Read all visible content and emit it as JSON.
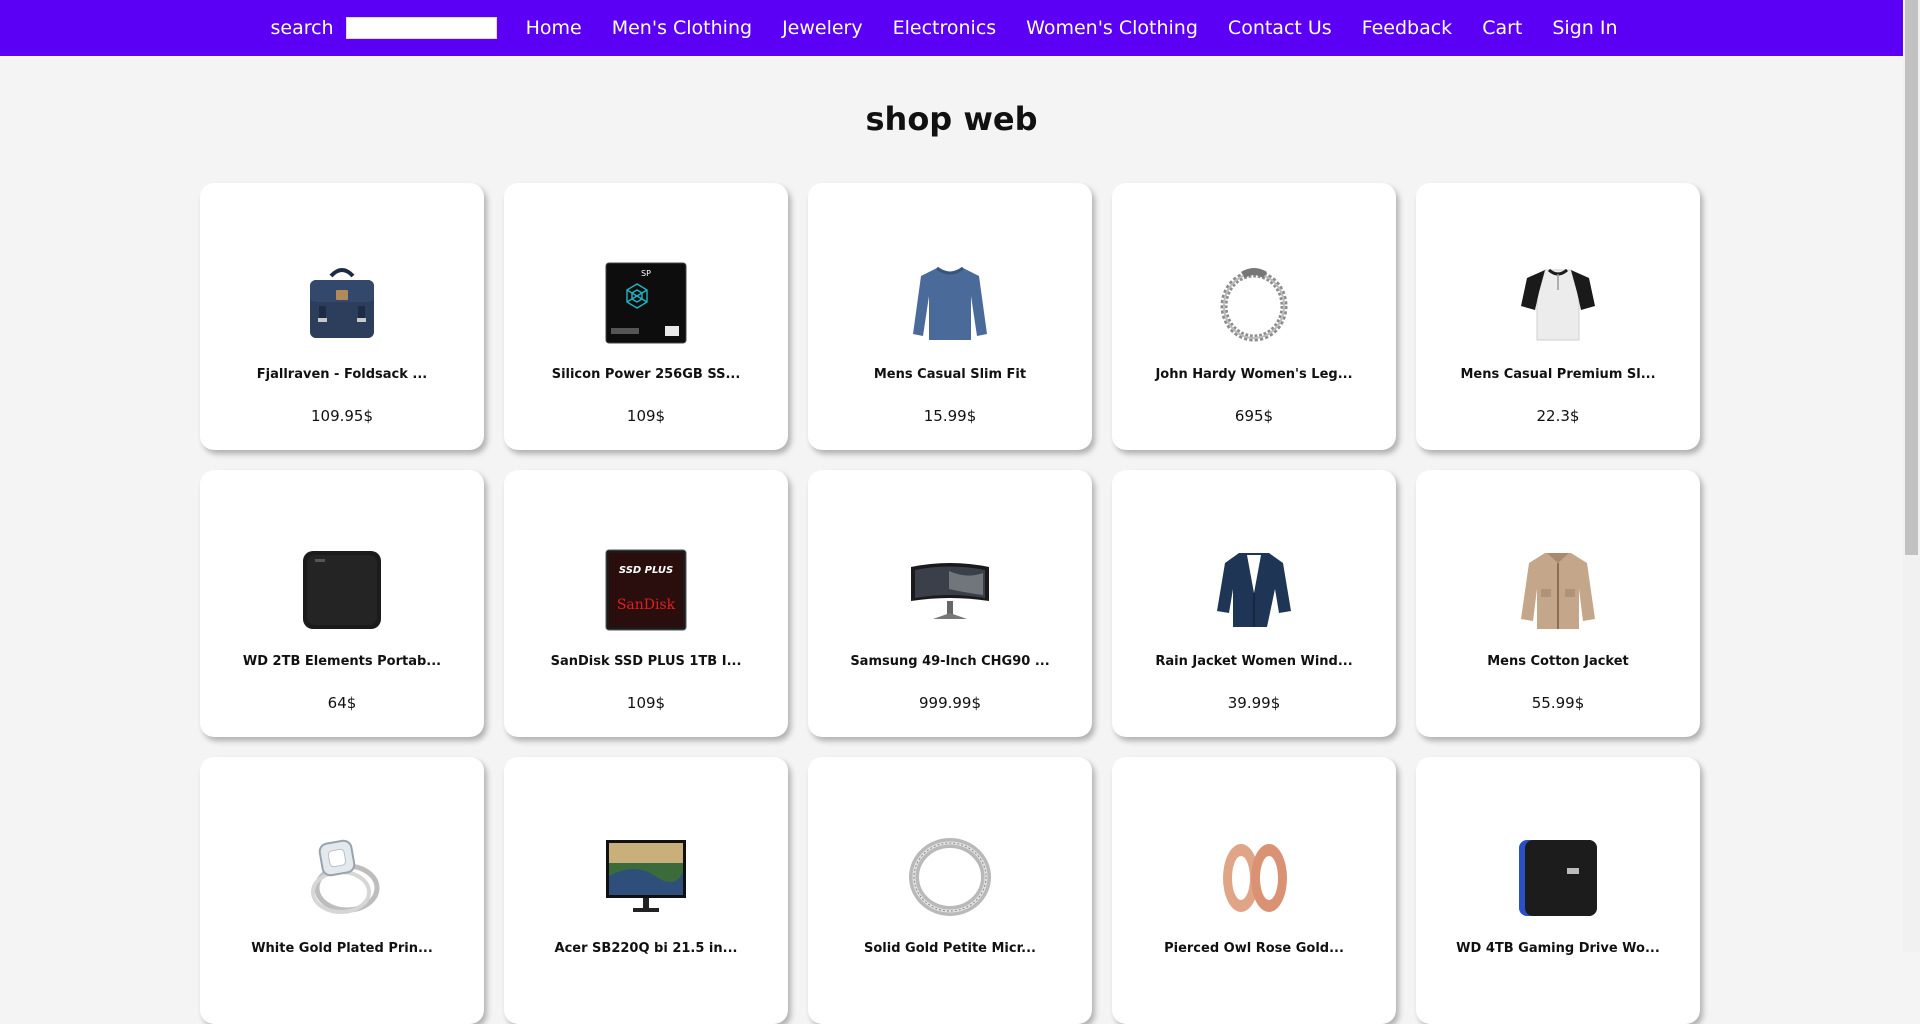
{
  "nav": {
    "search_label": "search",
    "search_value": "",
    "links": [
      "Home",
      "Men's Clothing",
      "Jewelery",
      "Electronics",
      "Women's Clothing",
      "Contact Us",
      "Feedback",
      "Cart",
      "Sign In"
    ]
  },
  "page": {
    "title": "shop web"
  },
  "colors": {
    "navbar": "#5b00f5",
    "background": "#f4f4f4",
    "card": "#ffffff"
  },
  "products": [
    {
      "title": "Fjallraven - Foldsack ...",
      "price": "109.95$",
      "icon": "backpack-icon"
    },
    {
      "title": "Silicon Power 256GB SS...",
      "price": "109$",
      "icon": "ssd-icon",
      "image_text": "SP"
    },
    {
      "title": "Mens Casual Slim Fit",
      "price": "15.99$",
      "icon": "long-sleeve-shirt-icon"
    },
    {
      "title": "John Hardy Women's Leg...",
      "price": "695$",
      "icon": "bracelet-icon"
    },
    {
      "title": "Mens Casual Premium Sl...",
      "price": "22.3$",
      "icon": "raglan-tshirt-icon"
    },
    {
      "title": "WD 2TB Elements Portab...",
      "price": "64$",
      "icon": "hard-drive-icon"
    },
    {
      "title": "SanDisk SSD PLUS 1TB I...",
      "price": "109$",
      "icon": "sandisk-ssd-icon",
      "image_text": "SSD PLUS",
      "image_brand": "SanDisk"
    },
    {
      "title": "Samsung 49-Inch CHG90 ...",
      "price": "999.99$",
      "icon": "curved-monitor-icon"
    },
    {
      "title": "Rain Jacket Women Wind...",
      "price": "39.99$",
      "icon": "blazer-icon"
    },
    {
      "title": "Mens Cotton Jacket",
      "price": "55.99$",
      "icon": "cotton-jacket-icon"
    },
    {
      "title": "White Gold Plated Prin...",
      "price": "",
      "icon": "diamond-ring-icon"
    },
    {
      "title": "Acer SB220Q bi 21.5 in...",
      "price": "",
      "icon": "monitor-icon"
    },
    {
      "title": "Solid Gold Petite Micr...",
      "price": "",
      "icon": "band-ring-icon"
    },
    {
      "title": "Pierced Owl Rose Gold...",
      "price": "",
      "icon": "ear-tunnel-icon"
    },
    {
      "title": "WD 4TB Gaming Drive Wo...",
      "price": "",
      "icon": "gaming-drive-icon"
    }
  ]
}
